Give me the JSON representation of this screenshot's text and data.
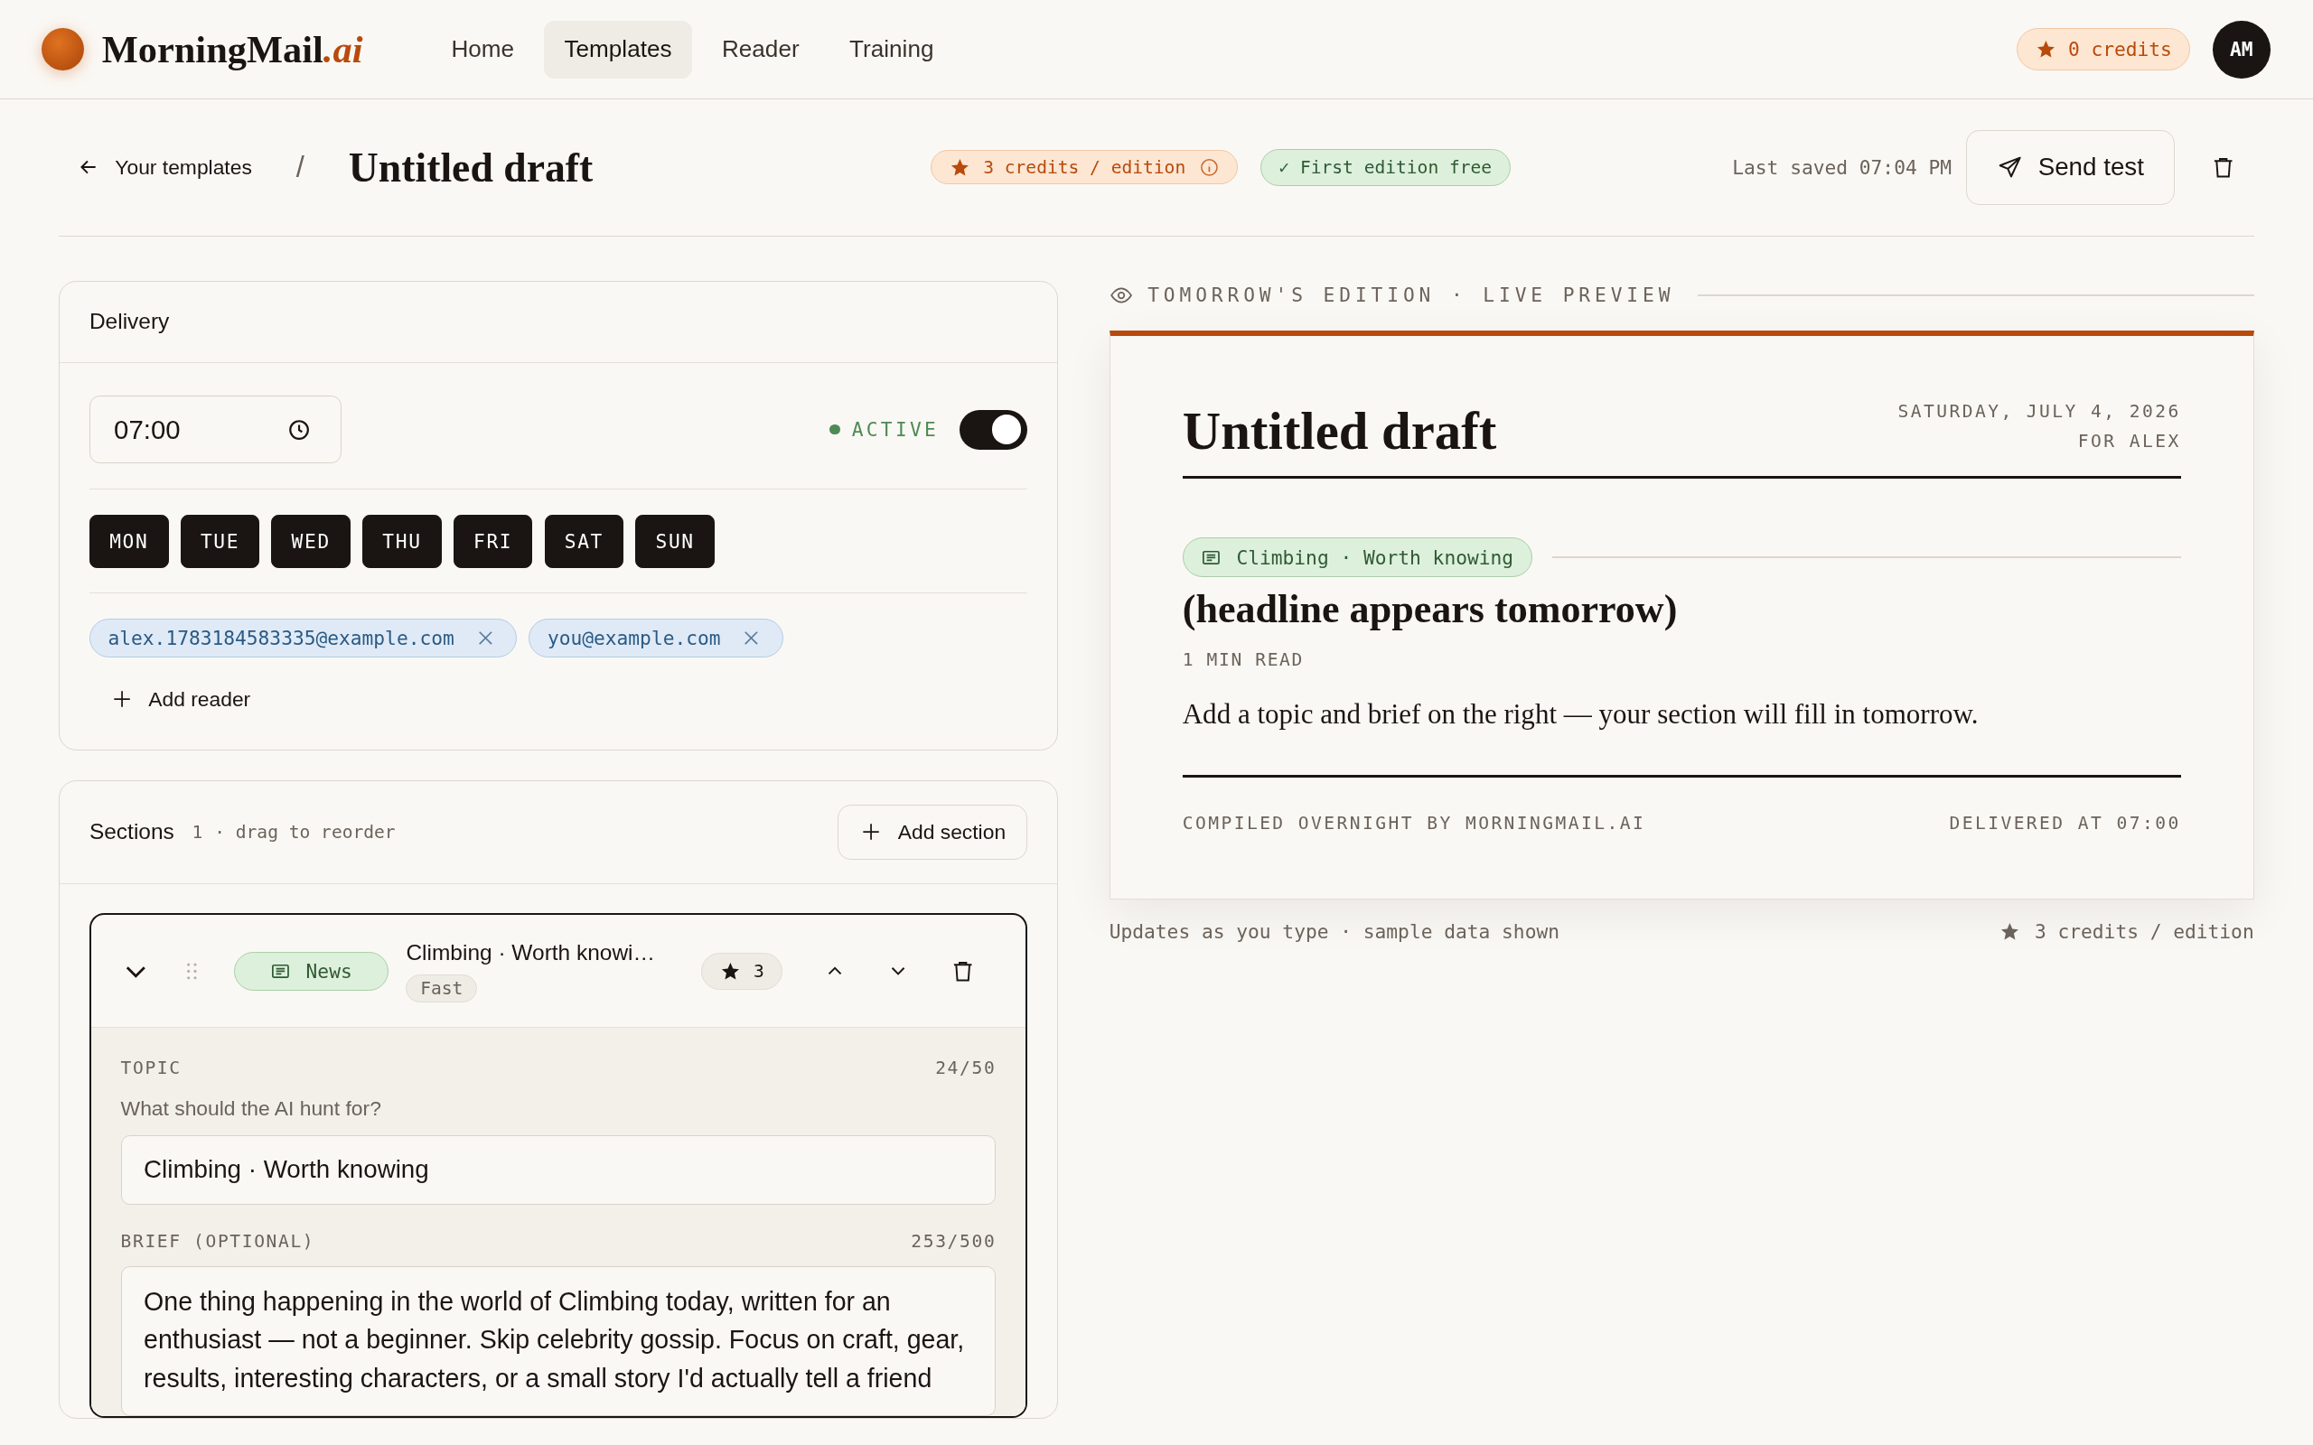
{
  "brand": {
    "name": "MorningMail",
    "suffix": ".ai"
  },
  "nav": [
    {
      "label": "Home",
      "selected": false
    },
    {
      "label": "Templates",
      "selected": true
    },
    {
      "label": "Reader",
      "selected": false
    },
    {
      "label": "Training",
      "selected": false
    }
  ],
  "credits_badge": "0 credits",
  "avatar": "AM",
  "header": {
    "back": "Your templates",
    "separator": "/",
    "title": "Untitled draft",
    "cost_badge": "3 credits / edition",
    "free_badge": "✓ First edition free",
    "last_saved": "Last saved 07:04 PM",
    "send_button": "Send test"
  },
  "delivery": {
    "title": "Delivery",
    "time": "07:00",
    "status": "ACTIVE",
    "active": true,
    "days": [
      {
        "label": "MON",
        "selected": true
      },
      {
        "label": "TUE",
        "selected": true
      },
      {
        "label": "WED",
        "selected": true
      },
      {
        "label": "THU",
        "selected": true
      },
      {
        "label": "FRI",
        "selected": true
      },
      {
        "label": "SAT",
        "selected": true
      },
      {
        "label": "SUN",
        "selected": true
      }
    ],
    "readers": [
      "alex.1783184583335@example.com",
      "you@example.com"
    ],
    "add_reader": "Add reader"
  },
  "sections_panel": {
    "title": "Sections",
    "count": "1",
    "hint": "· drag to reorder",
    "add_button": "Add section",
    "sections": [
      {
        "expanded": true,
        "type": "News",
        "title": "Climbing · Worth knowi…",
        "speed": "Fast",
        "cost": "3",
        "topic_label": "TOPIC",
        "topic_count": "24/50",
        "topic_hint": "What should the AI hunt for?",
        "topic": "Climbing · Worth knowing",
        "brief_label": "BRIEF (OPTIONAL)",
        "brief_count": "253/500",
        "brief": "One thing happening in the world of Climbing today, written for an enthusiast — not a beginner. Skip celebrity gossip. Focus on craft, gear, results, interesting characters, or a small story I'd actually tell a friend"
      }
    ]
  },
  "preview": {
    "label": "TOMORROW'S EDITION · LIVE PREVIEW",
    "title": "Untitled draft",
    "date": "SATURDAY, JULY 4, 2026",
    "recipient": "FOR ALEX",
    "tag": "Climbing · Worth knowing",
    "headline": "(headline appears tomorrow)",
    "read_time": "1 MIN READ",
    "body": "Add a topic and brief on the right — your section will fill in tomorrow.",
    "footer_left": "COMPILED OVERNIGHT BY MORNINGMAIL.AI",
    "footer_right": "DELIVERED AT 07:00",
    "note": "Updates as you type · sample data shown",
    "cost": "3 credits / edition"
  }
}
